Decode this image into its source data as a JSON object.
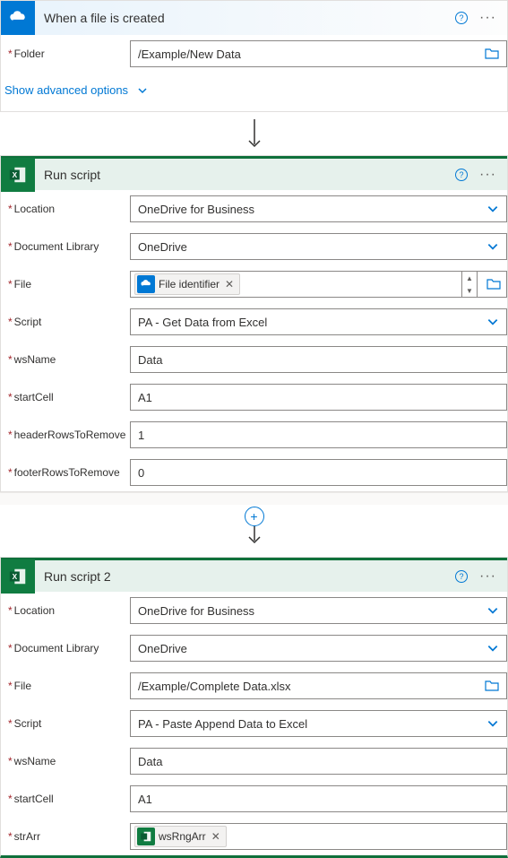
{
  "steps": [
    {
      "id": "onedrive-trigger",
      "icon": "onedrive",
      "headerStyle": "onedrive",
      "title": "When a file is created",
      "fields": [
        {
          "name": "folder",
          "label": "Folder",
          "type": "text-folder",
          "value": "/Example/New Data"
        }
      ],
      "advancedLink": "Show advanced options"
    },
    {
      "id": "run-script-1",
      "icon": "excel",
      "headerStyle": "excel",
      "title": "Run script",
      "fields": [
        {
          "name": "location",
          "label": "Location",
          "type": "select",
          "value": "OneDrive for Business"
        },
        {
          "name": "doclib",
          "label": "Document Library",
          "type": "select",
          "value": "OneDrive"
        },
        {
          "name": "file",
          "label": "File",
          "type": "token-stepper-folder",
          "token": {
            "style": "onedrive",
            "text": "File identifier"
          }
        },
        {
          "name": "script",
          "label": "Script",
          "type": "select",
          "value": "PA - Get Data from Excel"
        },
        {
          "name": "wsname",
          "label": "wsName",
          "type": "text",
          "value": "Data"
        },
        {
          "name": "startcell",
          "label": "startCell",
          "type": "text",
          "value": "A1"
        },
        {
          "name": "hrows",
          "label": "headerRowsToRemove",
          "type": "text",
          "value": "1"
        },
        {
          "name": "frows",
          "label": "footerRowsToRemove",
          "type": "text",
          "value": "0"
        }
      ]
    },
    {
      "id": "run-script-2",
      "icon": "excel",
      "headerStyle": "excel",
      "title": "Run script 2",
      "fields": [
        {
          "name": "location",
          "label": "Location",
          "type": "select",
          "value": "OneDrive for Business"
        },
        {
          "name": "doclib",
          "label": "Document Library",
          "type": "select",
          "value": "OneDrive"
        },
        {
          "name": "file",
          "label": "File",
          "type": "text-folder",
          "value": "/Example/Complete Data.xlsx"
        },
        {
          "name": "script",
          "label": "Script",
          "type": "select",
          "value": "PA - Paste Append Data to Excel"
        },
        {
          "name": "wsname",
          "label": "wsName",
          "type": "text",
          "value": "Data"
        },
        {
          "name": "startcell",
          "label": "startCell",
          "type": "text",
          "value": "A1"
        },
        {
          "name": "strarr",
          "label": "strArr",
          "type": "token",
          "token": {
            "style": "excel",
            "text": "wsRngArr"
          }
        }
      ]
    }
  ]
}
